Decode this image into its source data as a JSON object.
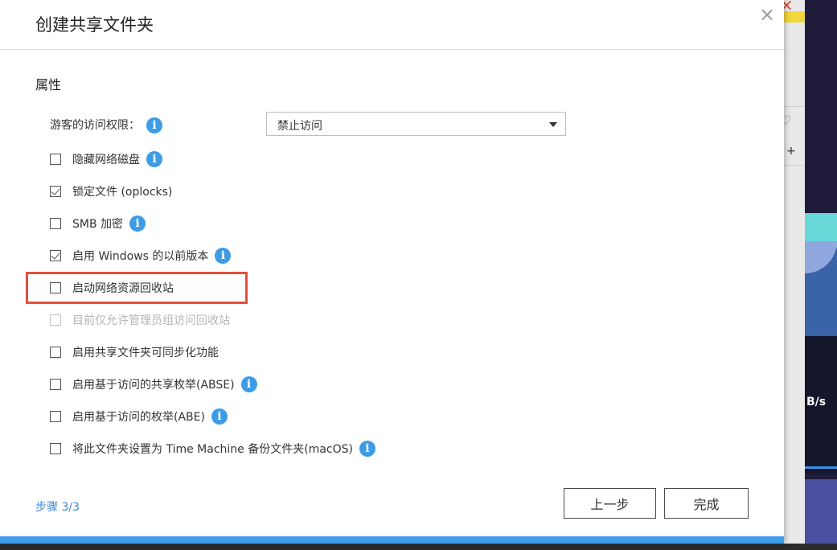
{
  "dialog": {
    "title": "创建共享文件夹",
    "close_glyph": "×"
  },
  "section": {
    "title": "属性"
  },
  "guest_access": {
    "label": "游客的访问权限：",
    "selected": "禁止访问"
  },
  "options": [
    {
      "label": "隐藏网络磁盘",
      "checked": false,
      "info": true
    },
    {
      "label": "锁定文件 (oplocks)",
      "checked": true,
      "info": false
    },
    {
      "label": "SMB 加密",
      "checked": false,
      "info": true
    },
    {
      "label": "启用 Windows 的以前版本",
      "checked": true,
      "info": true
    },
    {
      "label": "启动网络资源回收站",
      "checked": false,
      "info": false,
      "highlighted": true
    },
    {
      "label": "目前仅允许管理员组访问回收站",
      "checked": false,
      "info": false,
      "disabled": true
    },
    {
      "label": "启用共享文件夹可同步化功能",
      "checked": false,
      "info": false
    },
    {
      "label": "启用基于访问的共享枚举(ABSE)",
      "checked": false,
      "info": true
    },
    {
      "label": "启用基于访问的枚举(ABE)",
      "checked": false,
      "info": true
    },
    {
      "label": "将此文件夹设置为 Time Machine 备份文件夹(macOS)",
      "checked": false,
      "info": true
    }
  ],
  "footer": {
    "step": "步骤 3/3",
    "prev_label": "上一步",
    "done_label": "完成"
  },
  "background": {
    "rate_fragment": "B/s",
    "close_fragment": "×",
    "plus_glyph": "+",
    "fav_glyph": "♡"
  },
  "colors": {
    "accent": "#3e9be6",
    "highlight": "#e4503a",
    "step_link": "#3a8ad9"
  }
}
